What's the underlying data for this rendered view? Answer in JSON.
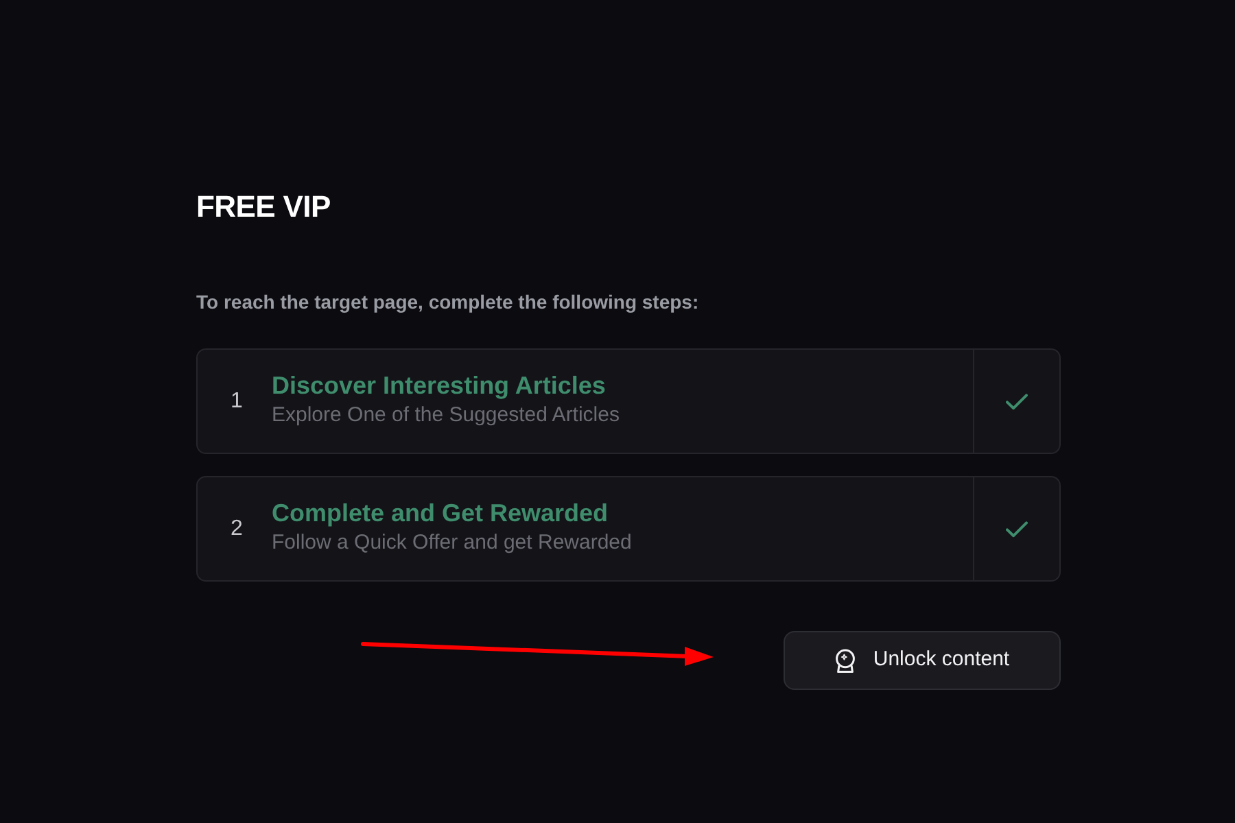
{
  "heading": "FREE VIP",
  "instructions": "To reach the target page, complete the following steps:",
  "steps": [
    {
      "number": "1",
      "title": "Discover Interesting Articles",
      "description": "Explore One of the Suggested Articles"
    },
    {
      "number": "2",
      "title": "Complete and Get Rewarded",
      "description": "Follow a Quick Offer and get Rewarded"
    }
  ],
  "button": {
    "label": "Unlock content"
  }
}
